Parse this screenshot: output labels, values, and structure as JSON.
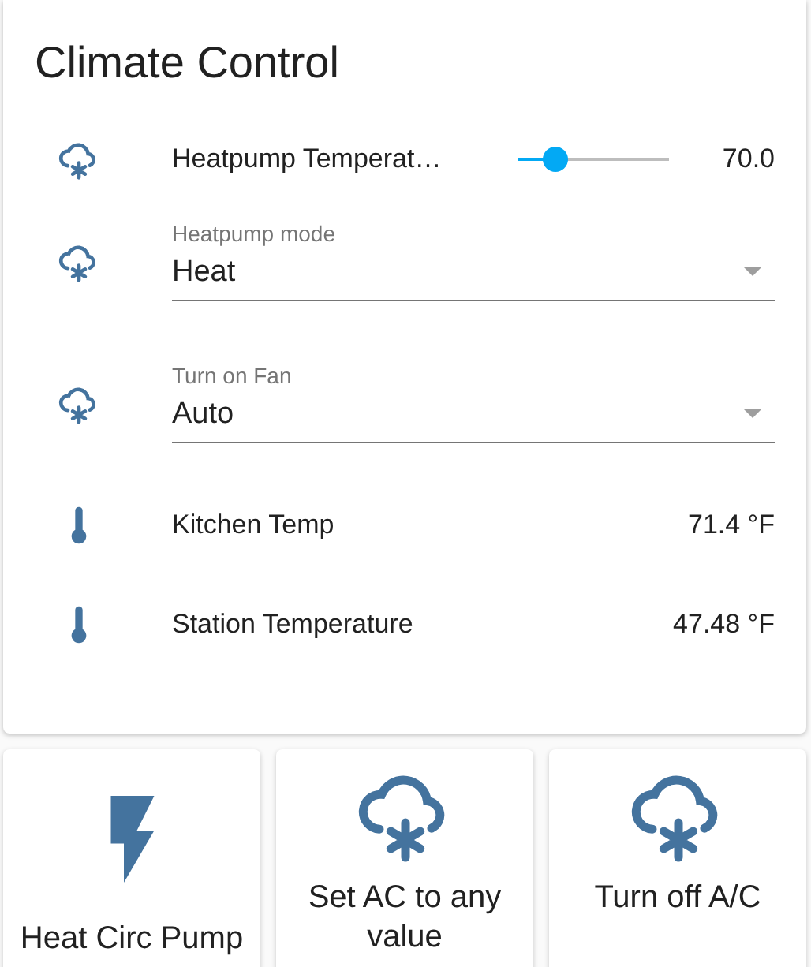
{
  "card": {
    "title": "Climate Control",
    "rows": [
      {
        "kind": "slider",
        "name": "Heatpump Temperat…",
        "level": 0.25,
        "value": "70.0"
      },
      {
        "kind": "select",
        "label": "Heatpump mode",
        "value": "Heat"
      },
      {
        "kind": "select",
        "label": "Turn on Fan",
        "value": "Auto"
      },
      {
        "kind": "sensor",
        "name": "Kitchen Temp",
        "value": "71.4 °F"
      },
      {
        "kind": "sensor",
        "name": "Station Temperature",
        "value": "47.48 °F"
      }
    ]
  },
  "buttons": [
    {
      "kind": "switch",
      "label": "Heat Circ Pump"
    },
    {
      "kind": "script",
      "label": "Set AC to any value"
    },
    {
      "kind": "script",
      "label": "Turn off A/C"
    }
  ]
}
